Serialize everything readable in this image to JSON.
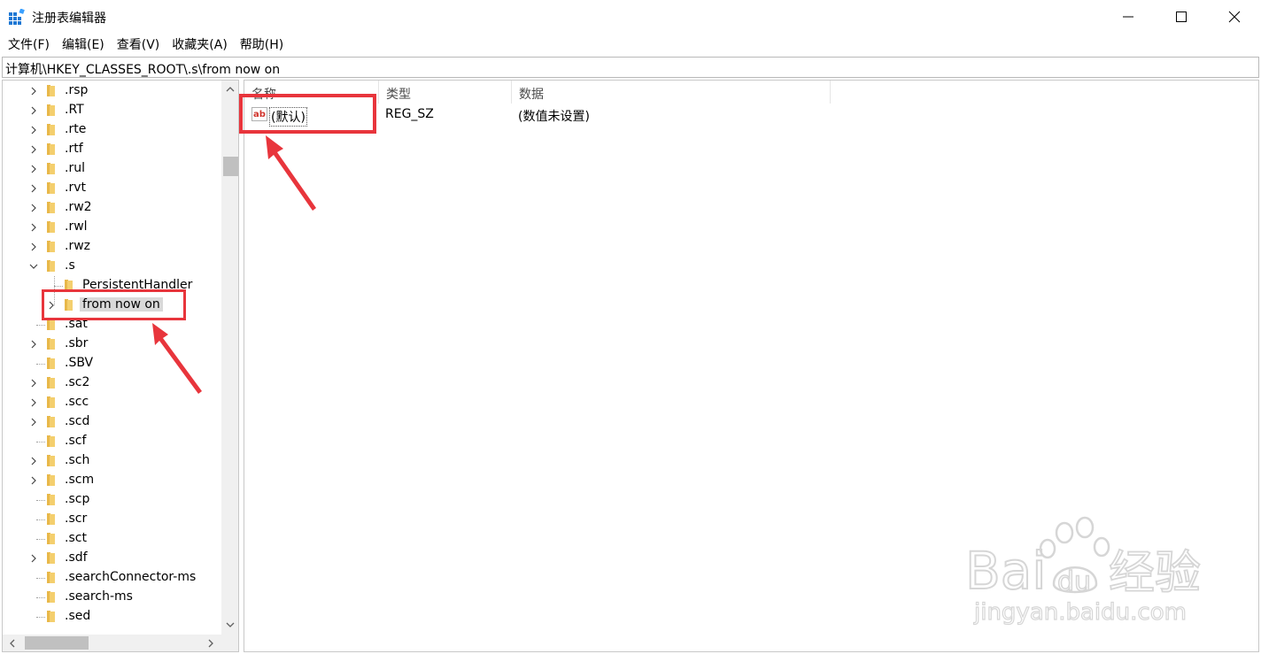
{
  "window": {
    "title": "注册表编辑器"
  },
  "menu": [
    "文件(F)",
    "编辑(E)",
    "查看(V)",
    "收藏夹(A)",
    "帮助(H)"
  ],
  "address": "计算机\\HKEY_CLASSES_ROOT\\.s\\from now on",
  "tree": {
    "items": [
      {
        "label": ".rsp",
        "expandable": true
      },
      {
        "label": ".RT",
        "expandable": true
      },
      {
        "label": ".rte",
        "expandable": true
      },
      {
        "label": ".rtf",
        "expandable": true
      },
      {
        "label": ".rul",
        "expandable": true
      },
      {
        "label": ".rvt",
        "expandable": true
      },
      {
        "label": ".rw2",
        "expandable": true
      },
      {
        "label": ".rwl",
        "expandable": true
      },
      {
        "label": ".rwz",
        "expandable": true
      },
      {
        "label": ".s",
        "expandable": true,
        "expanded": true
      },
      {
        "label": "PersistentHandler",
        "expandable": false,
        "child": true
      },
      {
        "label": "from now on",
        "expandable": true,
        "child": true,
        "selected": true
      },
      {
        "label": ".sat",
        "expandable": false
      },
      {
        "label": ".sbr",
        "expandable": true
      },
      {
        "label": ".SBV",
        "expandable": false
      },
      {
        "label": ".sc2",
        "expandable": true
      },
      {
        "label": ".scc",
        "expandable": true
      },
      {
        "label": ".scd",
        "expandable": true
      },
      {
        "label": ".scf",
        "expandable": false
      },
      {
        "label": ".sch",
        "expandable": true
      },
      {
        "label": ".scm",
        "expandable": true
      },
      {
        "label": ".scp",
        "expandable": false
      },
      {
        "label": ".scr",
        "expandable": false
      },
      {
        "label": ".sct",
        "expandable": false
      },
      {
        "label": ".sdf",
        "expandable": true
      },
      {
        "label": ".searchConnector-ms",
        "expandable": false
      },
      {
        "label": ".search-ms",
        "expandable": false
      },
      {
        "label": ".sed",
        "expandable": false
      }
    ]
  },
  "list": {
    "columns": [
      "名称",
      "类型",
      "数据"
    ],
    "rows": [
      {
        "name": "(默认)",
        "type": "REG_SZ",
        "data": "(数值未设置)"
      }
    ]
  },
  "watermark": {
    "brand": "Bai",
    "brand_du": "du",
    "brand_cn": "经验",
    "url": "jingyan.baidu.com"
  },
  "colors": {
    "highlight": "#e8353c",
    "folder": "#f4cf6e",
    "selection": "#d9d9d9"
  }
}
